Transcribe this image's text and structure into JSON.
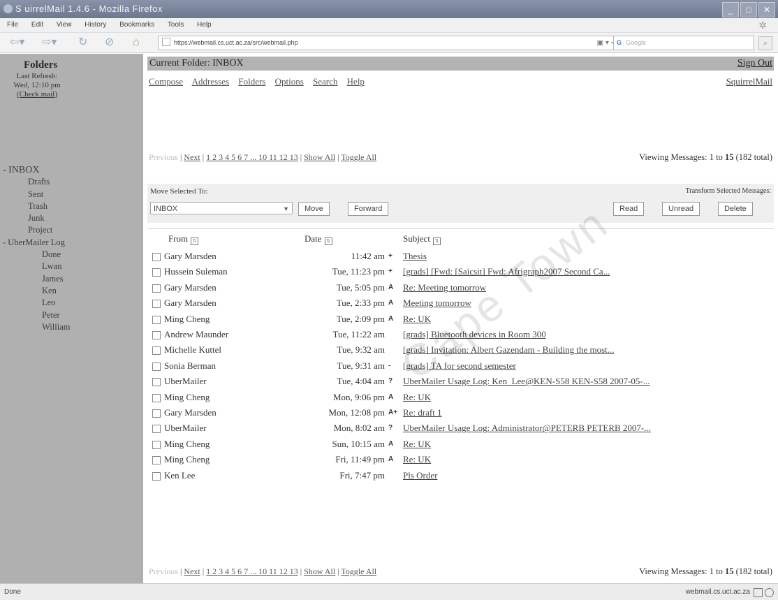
{
  "window": {
    "title": "S uirrelMail 1.4.6 - Mozilla Firefox"
  },
  "menu": [
    "File",
    "Edit",
    "View",
    "History",
    "Bookmarks",
    "Tools",
    "Help"
  ],
  "url": "https://webmail.cs.uct.ac.za/src/webmail.php",
  "search": {
    "engine": "G",
    "placeholder": "Google"
  },
  "sidebar": {
    "heading": "Folders",
    "last_refresh_label": "Last Refresh:",
    "last_refresh_time": "Wed, 12:10 pm",
    "check_mail": "(Check mail)",
    "folders": [
      {
        "label": "- INBOX",
        "level": 0
      },
      {
        "label": "Drafts",
        "level": 1
      },
      {
        "label": "Sent",
        "level": 1
      },
      {
        "label": "Trash",
        "level": 1
      },
      {
        "label": "Junk",
        "level": 1
      },
      {
        "label": "Project",
        "level": 1
      },
      {
        "label": "- UberMailer Log",
        "level": 0
      },
      {
        "label": "Done",
        "level": 2
      },
      {
        "label": "Lwan",
        "level": 2
      },
      {
        "label": "James",
        "level": 2
      },
      {
        "label": "Ken",
        "level": 2
      },
      {
        "label": "Leo",
        "level": 2
      },
      {
        "label": "Peter",
        "level": 2
      },
      {
        "label": "William",
        "level": 2
      }
    ]
  },
  "header": {
    "current_folder": "Current Folder: INBOX",
    "sign_out": "Sign Out",
    "nav": [
      "Compose",
      "Addresses",
      "Folders",
      "Options",
      "Search",
      "Help"
    ],
    "brand_link": "SquirrelMail"
  },
  "pager": {
    "previous": "Previous",
    "next": "Next",
    "pages": "1 2 3 4 5 6 7 ... 10 11 12 13",
    "show_all": "Show All",
    "toggle_all": "Toggle All",
    "viewing_prefix": "Viewing Messages: 1 to",
    "viewing_count": "15",
    "viewing_total": "(182 total)"
  },
  "actions": {
    "move_label": "Move Selected To:",
    "move_target": "INBOX",
    "move_btn": "Move",
    "forward_btn": "Forward",
    "transform_label": "Transform Selected Messages:",
    "read_btn": "Read",
    "unread_btn": "Unread",
    "delete_btn": "Delete"
  },
  "columns": {
    "from": "From",
    "date": "Date",
    "subject": "Subject"
  },
  "messages": [
    {
      "from": "Gary Marsden",
      "date": "11:42 am",
      "flag": "+",
      "subject": "Thesis"
    },
    {
      "from": "Hussein Suleman",
      "date": "Tue, 11:23 pm",
      "flag": "+",
      "subject": "[grads] [Fwd: [Saicsit] Fwd: Afrigraph2007 Second Ca..."
    },
    {
      "from": "Gary Marsden",
      "date": "Tue, 5:05 pm",
      "flag": "A",
      "subject": "Re: Meeting tomorrow"
    },
    {
      "from": "Gary Marsden",
      "date": "Tue, 2:33 pm",
      "flag": "A",
      "subject": "Meeting tomorrow"
    },
    {
      "from": "Ming Cheng",
      "date": "Tue, 2:09 pm",
      "flag": "A",
      "subject": "Re: UK"
    },
    {
      "from": "Andrew Maunder",
      "date": "Tue, 11:22 am",
      "flag": "",
      "subject": "[grads] Bluetooth devices in Room 300"
    },
    {
      "from": "Michelle Kuttel",
      "date": "Tue, 9:32 am",
      "flag": "",
      "subject": "[grads] Invitation: Albert Gazendam - Building the most..."
    },
    {
      "from": "Sonia Berman",
      "date": "Tue, 9:31 am",
      "flag": "-",
      "subject": "[grads] TA for second semester"
    },
    {
      "from": "UberMailer",
      "date": "Tue, 4:04 am",
      "flag": "?",
      "subject": "UberMailer Usage Log: Ken_Lee@KEN-S58 KEN-S58 2007-05-..."
    },
    {
      "from": "Ming Cheng",
      "date": "Mon, 9:06 pm",
      "flag": "A",
      "subject": "Re: UK"
    },
    {
      "from": "Gary Marsden",
      "date": "Mon, 12:08 pm",
      "flag": "A+",
      "subject": "Re: draft 1"
    },
    {
      "from": "UberMailer",
      "date": "Mon, 8:02 am",
      "flag": "?",
      "subject": "UberMailer Usage Log: Administrator@PETERB PETERB 2007-..."
    },
    {
      "from": "Ming Cheng",
      "date": "Sun, 10:15 am",
      "flag": "A",
      "subject": "Re: UK"
    },
    {
      "from": "Ming Cheng",
      "date": "Fri, 11:49 pm",
      "flag": "A",
      "subject": "Re: UK"
    },
    {
      "from": "Ken Lee",
      "date": "Fri, 7:47 pm",
      "flag": "",
      "subject": "Pls Order"
    }
  ],
  "status": {
    "left": "Done",
    "host": "webmail.cs.uct.ac.za"
  },
  "watermark": "Cape Town"
}
